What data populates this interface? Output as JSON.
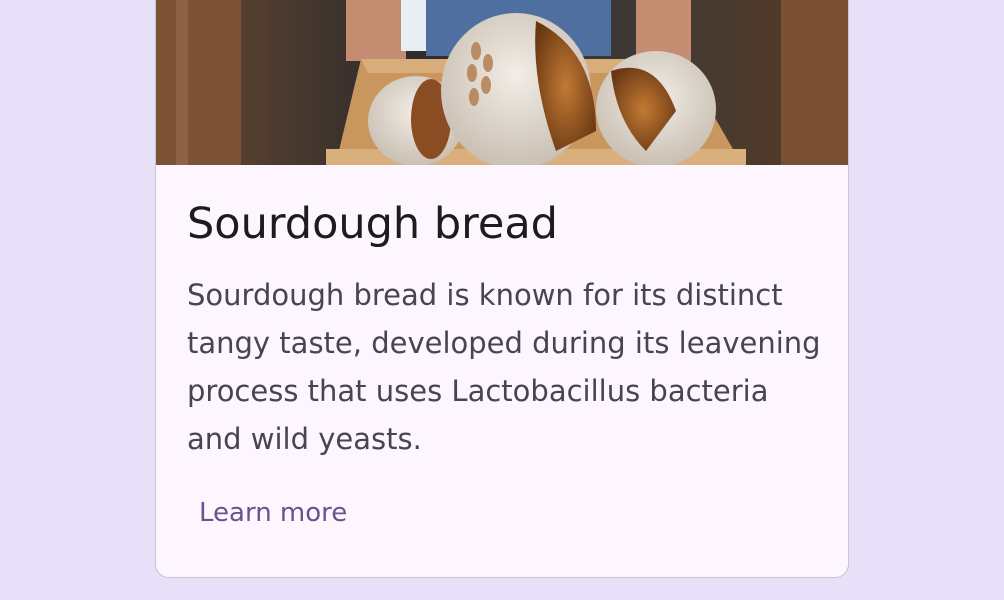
{
  "card": {
    "title": "Sourdough bread",
    "description": "Sourdough bread is known for its distinct tangy taste, developed during its leavening process that uses Lactobacillus bacteria and wild yeasts.",
    "action_label": "Learn more",
    "media_icon": "bread-photo"
  },
  "colors": {
    "page_background": "#e6e0f8",
    "card_surface": "#fdf6fe",
    "title": "#1d1b20",
    "body_text": "#49454f",
    "action_text": "#65558f"
  }
}
